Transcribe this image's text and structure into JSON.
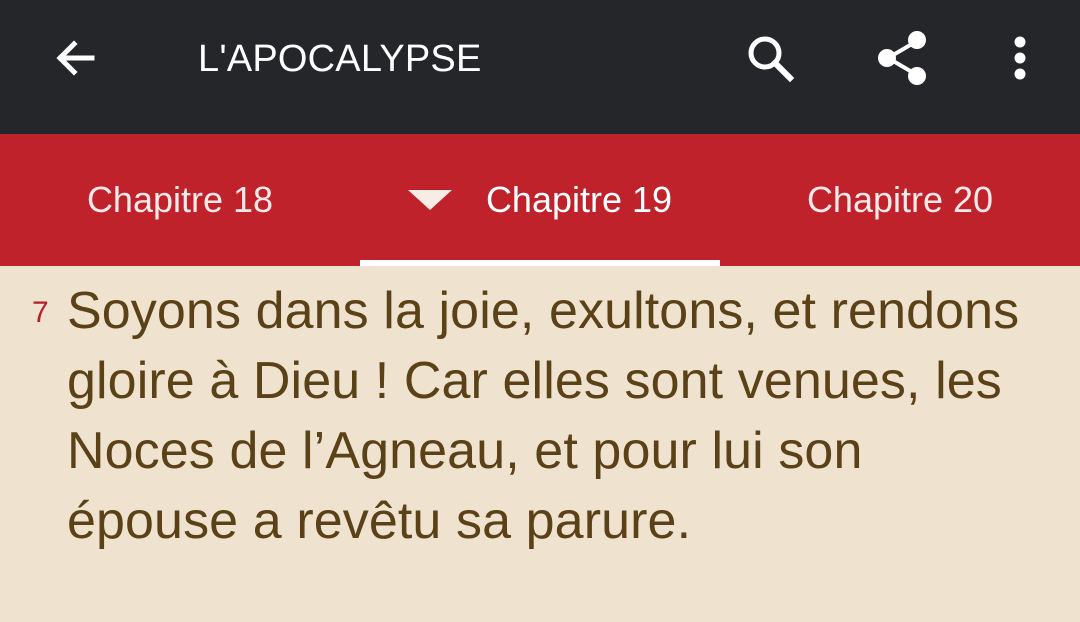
{
  "toolbar": {
    "title": "L'APOCALYPSE",
    "back_icon": "arrow-left-icon",
    "search_icon": "search-icon",
    "share_icon": "share-icon",
    "more_icon": "more-vertical-icon",
    "background": "#25262a"
  },
  "tabs": {
    "items": [
      {
        "label": "Chapitre 18",
        "selected": false
      },
      {
        "label": "Chapitre 19",
        "selected": true
      },
      {
        "label": "Chapitre 20",
        "selected": false
      }
    ],
    "dropdown_icon": "triangle-down-icon",
    "background": "#c0222b"
  },
  "content": {
    "verse_number": "7",
    "verse_text": "Soyons dans la joie, exultons, et rendons gloire à Dieu ! Car elles sont venues, les Noces de l’Agneau, et pour lui son épouse a revêtu sa parure.",
    "background": "#efe3cf",
    "text_color": "#5a4118",
    "number_color": "#b5202a"
  }
}
